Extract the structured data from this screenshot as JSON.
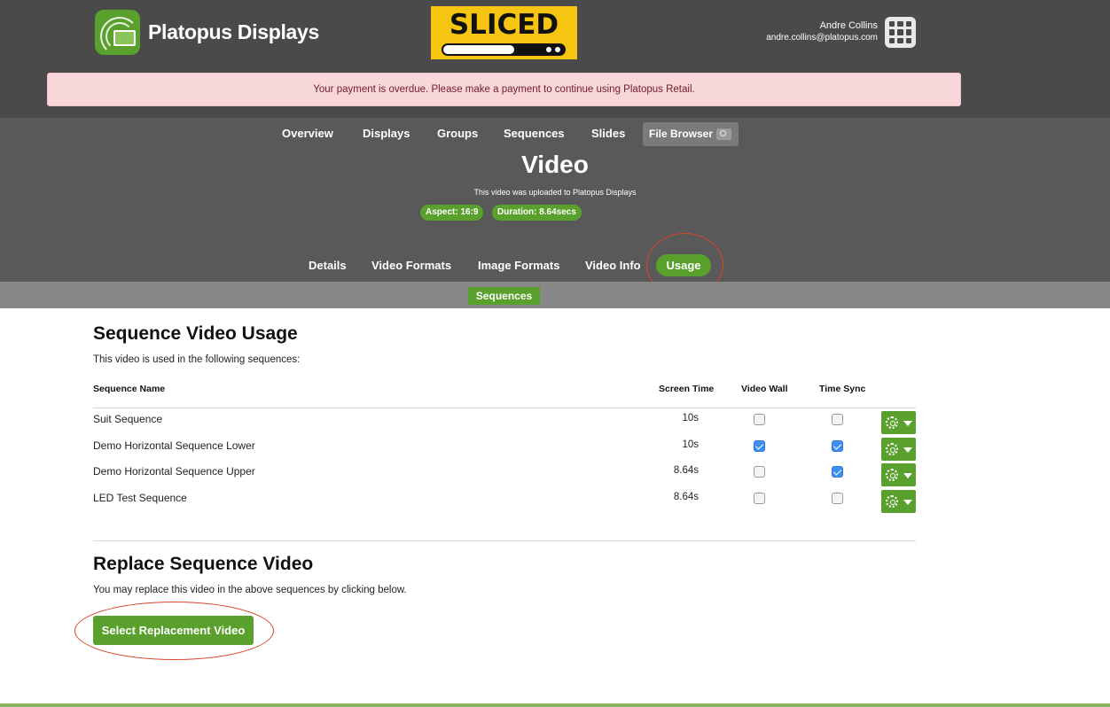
{
  "brand": {
    "name": "Platopus Displays",
    "accent": "#5aa02c"
  },
  "sliced_logo": {
    "text": "SLICED"
  },
  "user": {
    "name": "Andre Collins",
    "email": "andre.collins@platopus.com",
    "apps_icon": "grid-icon"
  },
  "alert": {
    "text": "Your payment is overdue. Please make a payment to continue using Platopus Retail."
  },
  "nav": {
    "items": [
      "Overview",
      "Displays",
      "Groups",
      "Sequences",
      "Slides"
    ],
    "file_browser": "File Browser"
  },
  "header": {
    "title": "Video",
    "subtitle": "This video was uploaded to Platopus Displays",
    "aspect": "Aspect: 16:9",
    "duration": "Duration: 8.64secs"
  },
  "tabs": {
    "items": [
      "Details",
      "Video Formats",
      "Image Formats",
      "Video Info"
    ],
    "active": "Usage"
  },
  "subtabs": {
    "active": "Sequences"
  },
  "usage": {
    "heading": "Sequence Video Usage",
    "intro": "This video is used in the following sequences:",
    "columns": [
      "Sequence Name",
      "Screen Time",
      "Video Wall",
      "Time Sync"
    ],
    "rows": [
      {
        "name": "Suit Sequence",
        "time": "10s",
        "video_wall": false,
        "time_sync": false
      },
      {
        "name": "Demo Horizontal Sequence Lower",
        "time": "10s",
        "video_wall": true,
        "time_sync": true
      },
      {
        "name": "Demo Horizontal Sequence Upper",
        "time": "8.64s",
        "video_wall": false,
        "time_sync": true
      },
      {
        "name": "LED Test Sequence",
        "time": "8.64s",
        "video_wall": false,
        "time_sync": false
      }
    ]
  },
  "replace": {
    "heading": "Replace Sequence Video",
    "intro": "You may replace this video in the above sequences by clicking below.",
    "button": "Select Replacement Video"
  }
}
